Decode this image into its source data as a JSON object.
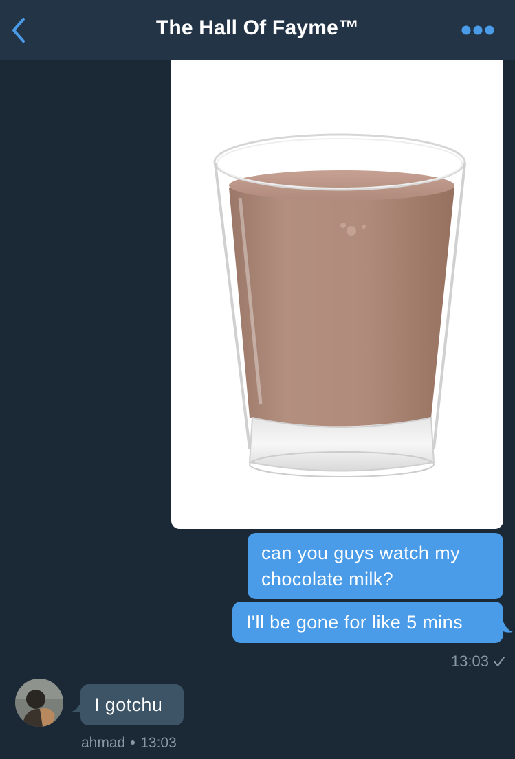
{
  "header": {
    "title": "The Hall Of Fayme™",
    "back_icon": "chevron-left-icon",
    "more_icon": "more-horizontal-icon",
    "accent_color": "#4a9ce8"
  },
  "conversation": {
    "sent_messages": [
      {
        "text": "can you guys watch my chocolate milk?"
      },
      {
        "text": "I'll be gone for like 5 mins"
      }
    ],
    "sent_timestamp": "13:03",
    "sent_image": {
      "description_icon": "chocolate-milk-glass-photo"
    },
    "received_messages": [
      {
        "sender": "ahmad",
        "text": "I gotchu",
        "timestamp": "13:03"
      }
    ]
  },
  "colors": {
    "background": "#1b2836",
    "header_background": "#243447",
    "sent_bubble": "#4a9ce8",
    "received_bubble": "#3d5466",
    "meta_text": "#8899a6"
  }
}
